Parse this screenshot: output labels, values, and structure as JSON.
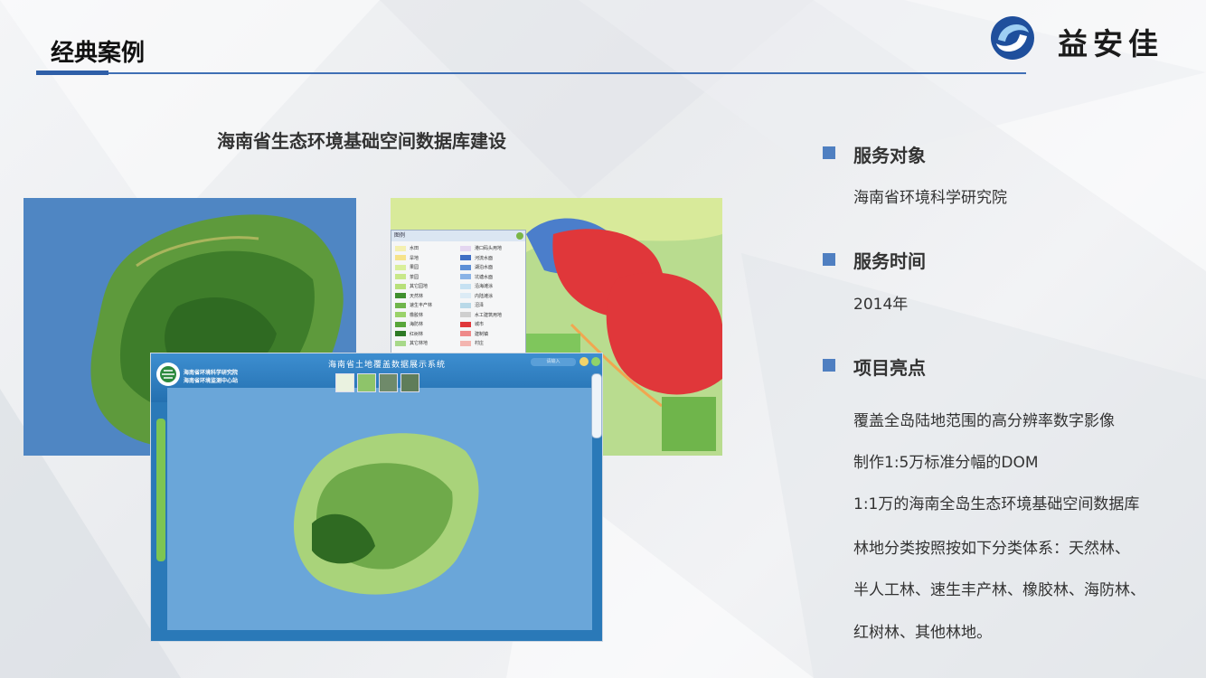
{
  "header": {
    "title": "经典案例",
    "brand": "益安佳"
  },
  "project": {
    "title": "海南省生态环境基础空间数据库建设"
  },
  "info": {
    "service_target": {
      "label": "服务对象",
      "value": "海南省环境科学研究院"
    },
    "service_time": {
      "label": "服务时间",
      "value": "2014年"
    },
    "highlights": {
      "label": "项目亮点",
      "items": [
        "覆盖全岛陆地范围的高分辨率数字影像",
        "制作1:5万标准分幅的DOM",
        "1:1万的海南全岛生态环境基础空间数据库",
        "林地分类按照按如下分类体系：天然林、",
        "半人工林、速生丰产林、橡胶林、海防林、",
        "红树林、其他林地。"
      ]
    }
  },
  "viewer": {
    "title": "海南省土地覆盖数据展示系统",
    "org_line1": "海南省环境科学研究院",
    "org_line2": "海南省环境监测中心站",
    "search_placeholder": "请输入"
  },
  "legend": {
    "title": "图例",
    "left": [
      {
        "label": "水田",
        "color": "#f4f0b0"
      },
      {
        "label": "旱地",
        "color": "#f6e38a"
      },
      {
        "label": "果园",
        "color": "#d9ef9a"
      },
      {
        "label": "茶园",
        "color": "#c8e88a"
      },
      {
        "label": "其它园地",
        "color": "#b7e07a"
      },
      {
        "label": "天然林",
        "color": "#3f8f2e"
      },
      {
        "label": "速生丰产林",
        "color": "#6fb54b"
      },
      {
        "label": "橡胶林",
        "color": "#9ad26a"
      },
      {
        "label": "海防林",
        "color": "#58a63a"
      },
      {
        "label": "红树林",
        "color": "#2e7a26"
      },
      {
        "label": "其它林地",
        "color": "#a8d98a"
      }
    ],
    "right": [
      {
        "label": "港口码头用地",
        "color": "#e4d6f0"
      },
      {
        "label": "河流水面",
        "color": "#3f6fc4"
      },
      {
        "label": "湖泊水面",
        "color": "#5d8fd6"
      },
      {
        "label": "坑塘水面",
        "color": "#8ab3e6"
      },
      {
        "label": "沿海滩涂",
        "color": "#c6e1f2"
      },
      {
        "label": "内陆滩涂",
        "color": "#dcebf5"
      },
      {
        "label": "沼泽",
        "color": "#b9d9e8"
      },
      {
        "label": "水工建筑用地",
        "color": "#cfcfcf"
      },
      {
        "label": "城市",
        "color": "#e0373a"
      },
      {
        "label": "建制镇",
        "color": "#ee8a8a"
      },
      {
        "label": "村庄",
        "color": "#f3b5b0"
      }
    ]
  }
}
